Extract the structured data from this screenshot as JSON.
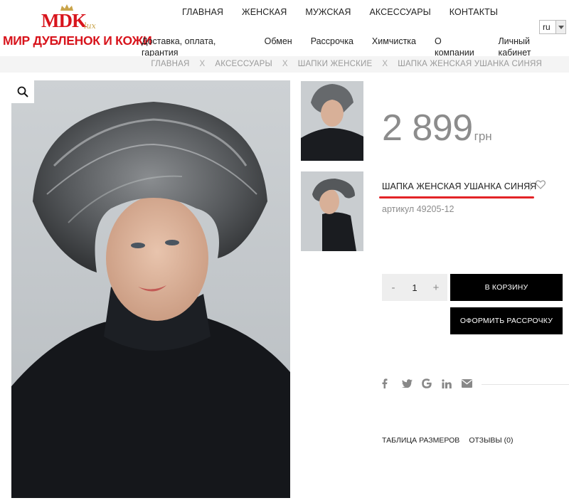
{
  "logo": {
    "brand": "MDK",
    "lux": "lux",
    "subtitle": "МИР ДУБЛЕНОК И КОЖИ",
    "brand_color": "#d8141c"
  },
  "main_nav": [
    "ГЛАВНАЯ",
    "ЖЕНСКАЯ",
    "МУЖСКАЯ",
    "АКСЕССУАРЫ",
    "КОНТАКТЫ"
  ],
  "sub_nav": [
    "Доставка, оплата, гарантия",
    "Обмен",
    "Рассрочка",
    "Химчистка",
    "О компании",
    "Личный кабинет"
  ],
  "language": {
    "selected": "ru"
  },
  "breadcrumb": {
    "items": [
      "ГЛАВНАЯ",
      "АКСЕССУАРЫ",
      "ШАПКИ ЖЕНСКИЕ",
      "ШАПКА ЖЕНСКАЯ УШАНКА СИНЯЯ"
    ],
    "separator": "X"
  },
  "product": {
    "price": "2 899",
    "currency": "грн",
    "title": "ШАПКА ЖЕНСКАЯ УШАНКА СИНЯЯ",
    "sku": "артикул 49205-12",
    "quantity": "1",
    "quantity_minus": "-",
    "quantity_plus": "+",
    "add_to_cart": "В КОРЗИНУ",
    "installment": "ОФОРМИТЬ РАССРОЧКУ"
  },
  "icons": {
    "zoom": "search-icon",
    "favorite": "heart-icon",
    "share": [
      "facebook-icon",
      "twitter-icon",
      "google-icon",
      "linkedin-icon",
      "email-icon"
    ]
  },
  "tabs": [
    "ТАБЛИЦА РАЗМЕРОВ",
    "ОТЗЫВЫ (0)"
  ],
  "colors": {
    "accent_red": "#e32327",
    "button_black": "#000000",
    "price_gray": "#8c8c8c"
  }
}
